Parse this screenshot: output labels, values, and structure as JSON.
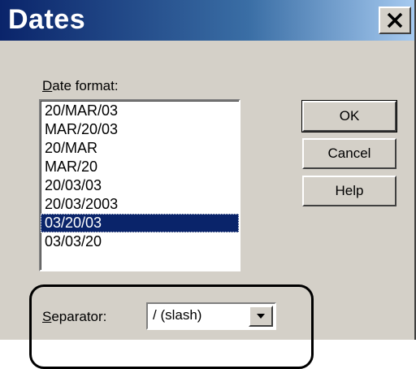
{
  "window": {
    "title": "Dates",
    "close_label": "X"
  },
  "date_format": {
    "label_underlined": "D",
    "label_rest": "ate format:",
    "items": [
      {
        "text": "20/MAR/03",
        "selected": false
      },
      {
        "text": "MAR/20/03",
        "selected": false
      },
      {
        "text": "20/MAR",
        "selected": false
      },
      {
        "text": "MAR/20",
        "selected": false
      },
      {
        "text": "20/03/03",
        "selected": false
      },
      {
        "text": "20/03/2003",
        "selected": false
      },
      {
        "text": "03/20/03",
        "selected": true
      },
      {
        "text": "03/03/20",
        "selected": false
      }
    ]
  },
  "buttons": {
    "ok": "OK",
    "cancel": "Cancel",
    "help": "Help"
  },
  "separator": {
    "label_underlined": "S",
    "label_rest": "eparator:",
    "value": "/ (slash)"
  },
  "colors": {
    "dialog_face": "#d4d0c8",
    "titlebar_start": "#0a246a",
    "titlebar_end": "#a6caf0",
    "selection": "#0a246a"
  }
}
